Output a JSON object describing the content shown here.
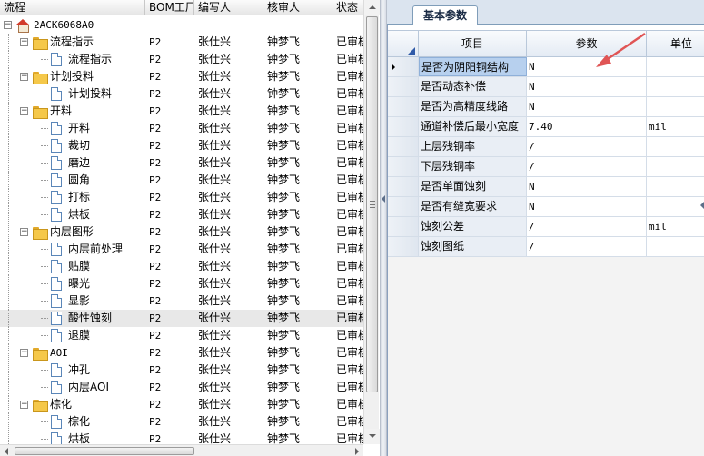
{
  "left_header": {
    "col_flow": "流程",
    "col_bom": "BOM工厂",
    "col_writer": "编写人",
    "col_reviewer": "核审人",
    "col_status": "状态"
  },
  "tree_rows": [
    {
      "level": 0,
      "icon": "home-icon",
      "expand": "minus",
      "label": "2ACK6068A0",
      "mono": true,
      "bom": "",
      "writer": "",
      "reviewer": "",
      "status": ""
    },
    {
      "level": 1,
      "icon": "folder-icon",
      "expand": "minus",
      "label": "流程指示",
      "bom": "P2",
      "writer": "张仕兴",
      "reviewer": "钟梦飞",
      "status": "已审核"
    },
    {
      "level": 2,
      "icon": "document-icon",
      "label": "流程指示",
      "bom": "P2",
      "writer": "张仕兴",
      "reviewer": "钟梦飞",
      "status": "已审核"
    },
    {
      "level": 1,
      "icon": "folder-icon",
      "expand": "minus",
      "label": "计划投料",
      "bom": "P2",
      "writer": "张仕兴",
      "reviewer": "钟梦飞",
      "status": "已审核"
    },
    {
      "level": 2,
      "icon": "document-icon",
      "label": "计划投料",
      "bom": "P2",
      "writer": "张仕兴",
      "reviewer": "钟梦飞",
      "status": "已审核"
    },
    {
      "level": 1,
      "icon": "folder-icon",
      "expand": "minus",
      "label": "开料",
      "bom": "P2",
      "writer": "张仕兴",
      "reviewer": "钟梦飞",
      "status": "已审核"
    },
    {
      "level": 2,
      "icon": "document-icon",
      "label": "开料",
      "bom": "P2",
      "writer": "张仕兴",
      "reviewer": "钟梦飞",
      "status": "已审核"
    },
    {
      "level": 2,
      "icon": "document-icon",
      "label": "裁切",
      "bom": "P2",
      "writer": "张仕兴",
      "reviewer": "钟梦飞",
      "status": "已审核"
    },
    {
      "level": 2,
      "icon": "document-icon",
      "label": "磨边",
      "bom": "P2",
      "writer": "张仕兴",
      "reviewer": "钟梦飞",
      "status": "已审核"
    },
    {
      "level": 2,
      "icon": "document-icon",
      "label": "圆角",
      "bom": "P2",
      "writer": "张仕兴",
      "reviewer": "钟梦飞",
      "status": "已审核"
    },
    {
      "level": 2,
      "icon": "document-icon",
      "label": "打标",
      "bom": "P2",
      "writer": "张仕兴",
      "reviewer": "钟梦飞",
      "status": "已审核"
    },
    {
      "level": 2,
      "icon": "document-icon",
      "label": "烘板",
      "bom": "P2",
      "writer": "张仕兴",
      "reviewer": "钟梦飞",
      "status": "已审核"
    },
    {
      "level": 1,
      "icon": "folder-icon",
      "expand": "minus",
      "label": "内层图形",
      "bom": "P2",
      "writer": "张仕兴",
      "reviewer": "钟梦飞",
      "status": "已审核"
    },
    {
      "level": 2,
      "icon": "document-icon",
      "label": "内层前处理",
      "bom": "P2",
      "writer": "张仕兴",
      "reviewer": "钟梦飞",
      "status": "已审核"
    },
    {
      "level": 2,
      "icon": "document-icon",
      "label": "贴膜",
      "bom": "P2",
      "writer": "张仕兴",
      "reviewer": "钟梦飞",
      "status": "已审核"
    },
    {
      "level": 2,
      "icon": "document-icon",
      "label": "曝光",
      "bom": "P2",
      "writer": "张仕兴",
      "reviewer": "钟梦飞",
      "status": "已审核"
    },
    {
      "level": 2,
      "icon": "document-icon",
      "label": "显影",
      "bom": "P2",
      "writer": "张仕兴",
      "reviewer": "钟梦飞",
      "status": "已审核"
    },
    {
      "level": 2,
      "icon": "document-icon",
      "label": "酸性蚀刻",
      "selected": true,
      "bom": "P2",
      "writer": "张仕兴",
      "reviewer": "钟梦飞",
      "status": "已审核"
    },
    {
      "level": 2,
      "icon": "document-icon",
      "label": "退膜",
      "bom": "P2",
      "writer": "张仕兴",
      "reviewer": "钟梦飞",
      "status": "已审核"
    },
    {
      "level": 1,
      "icon": "folder-icon",
      "expand": "minus",
      "label": "AOI",
      "mono": true,
      "bom": "P2",
      "writer": "张仕兴",
      "reviewer": "钟梦飞",
      "status": "已审核"
    },
    {
      "level": 2,
      "icon": "document-icon",
      "label": "冲孔",
      "bom": "P2",
      "writer": "张仕兴",
      "reviewer": "钟梦飞",
      "status": "已审核"
    },
    {
      "level": 2,
      "icon": "document-icon",
      "label": "内层AOI",
      "bom": "P2",
      "writer": "张仕兴",
      "reviewer": "钟梦飞",
      "status": "已审核"
    },
    {
      "level": 1,
      "icon": "folder-icon",
      "expand": "minus",
      "label": "棕化",
      "bom": "P2",
      "writer": "张仕兴",
      "reviewer": "钟梦飞",
      "status": "已审核"
    },
    {
      "level": 2,
      "icon": "document-icon",
      "label": "棕化",
      "bom": "P2",
      "writer": "张仕兴",
      "reviewer": "钟梦飞",
      "status": "已审核"
    },
    {
      "level": 2,
      "icon": "document-icon",
      "label": "烘板",
      "bom": "P2",
      "writer": "张仕兴",
      "reviewer": "钟梦飞",
      "status": "已审核"
    }
  ],
  "right_panel": {
    "tab_label": "基本参数",
    "col_item": "项目",
    "col_param": "参数",
    "col_unit": "单位",
    "rows": [
      {
        "item": "是否为阴阳铜结构",
        "param": "N",
        "unit": "",
        "current": true
      },
      {
        "item": "是否动态补偿",
        "param": "N",
        "unit": ""
      },
      {
        "item": "是否为高精度线路",
        "param": "N",
        "unit": ""
      },
      {
        "item": "通道补偿后最小宽度",
        "param": "7.40",
        "unit": "mil"
      },
      {
        "item": "上层残铜率",
        "param": "/",
        "unit": ""
      },
      {
        "item": "下层残铜率",
        "param": "/",
        "unit": ""
      },
      {
        "item": "是否单面蚀刻",
        "param": "N",
        "unit": ""
      },
      {
        "item": "是否有缝宽要求",
        "param": "N",
        "unit": ""
      },
      {
        "item": "蚀刻公差",
        "param": "/",
        "unit": "mil"
      },
      {
        "item": "蚀刻图纸",
        "param": "/",
        "unit": ""
      }
    ]
  },
  "colors": {
    "annotation_arrow": "#e05555",
    "selected_row": "#e8e8e8",
    "current_item_cell": "#b7d0ee"
  }
}
